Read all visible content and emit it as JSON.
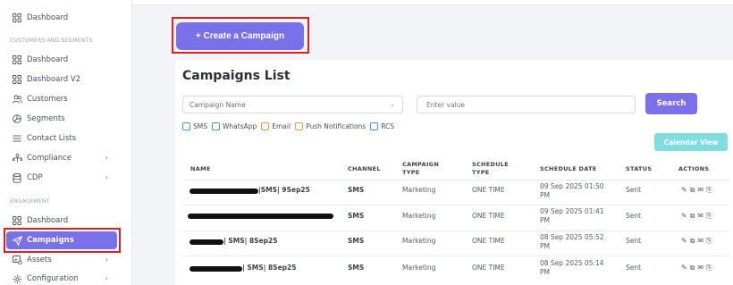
{
  "sidebar": {
    "top_item": "Dashboard",
    "section_customers": "CUSTOMERS AND SEGMENTS",
    "customers_items": [
      {
        "label": "Dashboard",
        "icon": "grid-icon"
      },
      {
        "label": "Dashboard V2",
        "icon": "grid-icon"
      },
      {
        "label": "Customers",
        "icon": "users-icon"
      },
      {
        "label": "Segments",
        "icon": "pie-icon"
      },
      {
        "label": "Contact Lists",
        "icon": "list-icon"
      },
      {
        "label": "Compliance",
        "icon": "compliance-icon"
      },
      {
        "label": "CDP",
        "icon": "database-icon"
      }
    ],
    "section_engagement": "ENGAGEMENT",
    "engagement_items": [
      {
        "label": "Dashboard",
        "icon": "grid-icon"
      },
      {
        "label": "Campaigns",
        "icon": "send-icon"
      },
      {
        "label": "Assets",
        "icon": "assets-icon"
      },
      {
        "label": "Configuration",
        "icon": "gear-icon"
      }
    ]
  },
  "main": {
    "create_button": "+ Create a Campaign",
    "list_title": "Campaigns List",
    "filter": {
      "select_value": "Campaign Name",
      "input_placeholder": "Enter value",
      "search_button": "Search"
    },
    "channels": [
      "SMS",
      "WhatsApp",
      "Email",
      "Push Notifications",
      "RCS"
    ],
    "calendar_button": "Calendar View",
    "table": {
      "headers": {
        "name": "NAME",
        "channel": "CHANNEL",
        "campaign_type": "CAMPAIGN TYPE",
        "schedule_type": "SCHEDULE TYPE",
        "schedule_date": "SCHEDULE DATE",
        "status": "STATUS",
        "actions": "ACTIONS"
      },
      "rows": [
        {
          "name": "|SMS| 9Sep25",
          "channel": "SMS",
          "campaign_type": "Marketing",
          "schedule_type": "ONE TIME",
          "schedule_date": "09 Sep 2025 01:50 PM",
          "status": "Sent"
        },
        {
          "name": "",
          "channel": "SMS",
          "campaign_type": "Marketing",
          "schedule_type": "ONE TIME",
          "schedule_date": "09 Sep 2025 01:41 PM",
          "status": "Sent"
        },
        {
          "name": "| SMS| 8Sep25",
          "channel": "SMS",
          "campaign_type": "Marketing",
          "schedule_type": "ONE TIME",
          "schedule_date": "08 Sep 2025 05:52 PM",
          "status": "Sent"
        },
        {
          "name": "| SMS| 8Sep25",
          "channel": "SMS",
          "campaign_type": "Marketing",
          "schedule_type": "ONE TIME",
          "schedule_date": "08 Sep 2025 05:14 PM",
          "status": "Sent"
        }
      ]
    }
  },
  "colors": {
    "accent": "#7a70ea",
    "calendar": "#7fdde0",
    "highlight": "#e0201f"
  }
}
